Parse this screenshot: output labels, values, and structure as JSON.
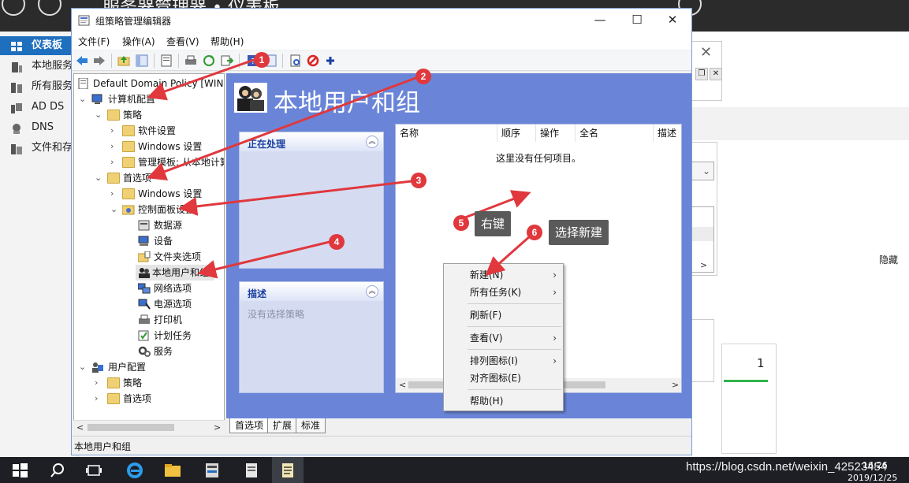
{
  "server_manager": {
    "title": "服务器管理器 • 仪表板",
    "sidebar": [
      {
        "label": "仪表板",
        "active": true
      },
      {
        "label": "本地服务器"
      },
      {
        "label": "所有服务器"
      },
      {
        "label": "AD DS"
      },
      {
        "label": "DNS"
      },
      {
        "label": "文件和存储服务"
      }
    ],
    "hide_label": "隐藏",
    "tile_count": "1",
    "close_glyph": "✕"
  },
  "gpe": {
    "title": "组策略管理编辑器",
    "window_buttons": {
      "minimize": "—",
      "maximize": "☐",
      "close": "✕"
    },
    "menu": [
      "文件(F)",
      "操作(A)",
      "查看(V)",
      "帮助(H)"
    ],
    "tree": {
      "root": "Default Domain Policy [WIN-",
      "computer_config": "计算机配置",
      "policies": "策略",
      "software_settings": "软件设置",
      "windows_settings": "Windows 设置",
      "admin_templates": "管理模板: 从本地计算机",
      "preferences": "首选项",
      "pref_windows_settings": "Windows 设置",
      "control_panel_settings": "控制面板设置",
      "data_sources": "数据源",
      "devices": "设备",
      "folder_options": "文件夹选项",
      "local_users_groups": "本地用户和组",
      "network_options": "网络选项",
      "power_options": "电源选项",
      "printers": "打印机",
      "scheduled_tasks": "计划任务",
      "services": "服务",
      "user_config": "用户配置",
      "user_policies": "策略",
      "user_preferences": "首选项"
    },
    "right_pane": {
      "title": "本地用户和组",
      "processing_panel": "正在处理",
      "description_panel": "描述",
      "description_text": "没有选择策略",
      "columns": [
        "名称",
        "顺序",
        "操作",
        "全名",
        "描述"
      ],
      "empty_message": "这里没有任何项目。"
    },
    "tabs": [
      "首选项",
      "扩展",
      "标准"
    ],
    "status": "本地用户和组"
  },
  "context_menu": {
    "items": [
      {
        "label": "新建(N)",
        "submenu": true
      },
      {
        "label": "所有任务(K)",
        "submenu": true
      },
      {
        "label": "刷新(F)",
        "submenu": false
      },
      {
        "label": "查看(V)",
        "submenu": true
      },
      {
        "label": "排列图标(I)",
        "submenu": true
      },
      {
        "label": "对齐图标(E)",
        "submenu": false
      },
      {
        "label": "帮助(H)",
        "submenu": false
      }
    ]
  },
  "annotations": {
    "badges": [
      "1",
      "2",
      "3",
      "4",
      "5",
      "6"
    ],
    "tip_right_click": "右键",
    "tip_select_new": "选择新建",
    "color": "#e0383d"
  },
  "taskbar": {
    "watermark": "https://blog.csdn.net/weixin_42523454",
    "time": "16:26",
    "date": "2019/12/25"
  }
}
